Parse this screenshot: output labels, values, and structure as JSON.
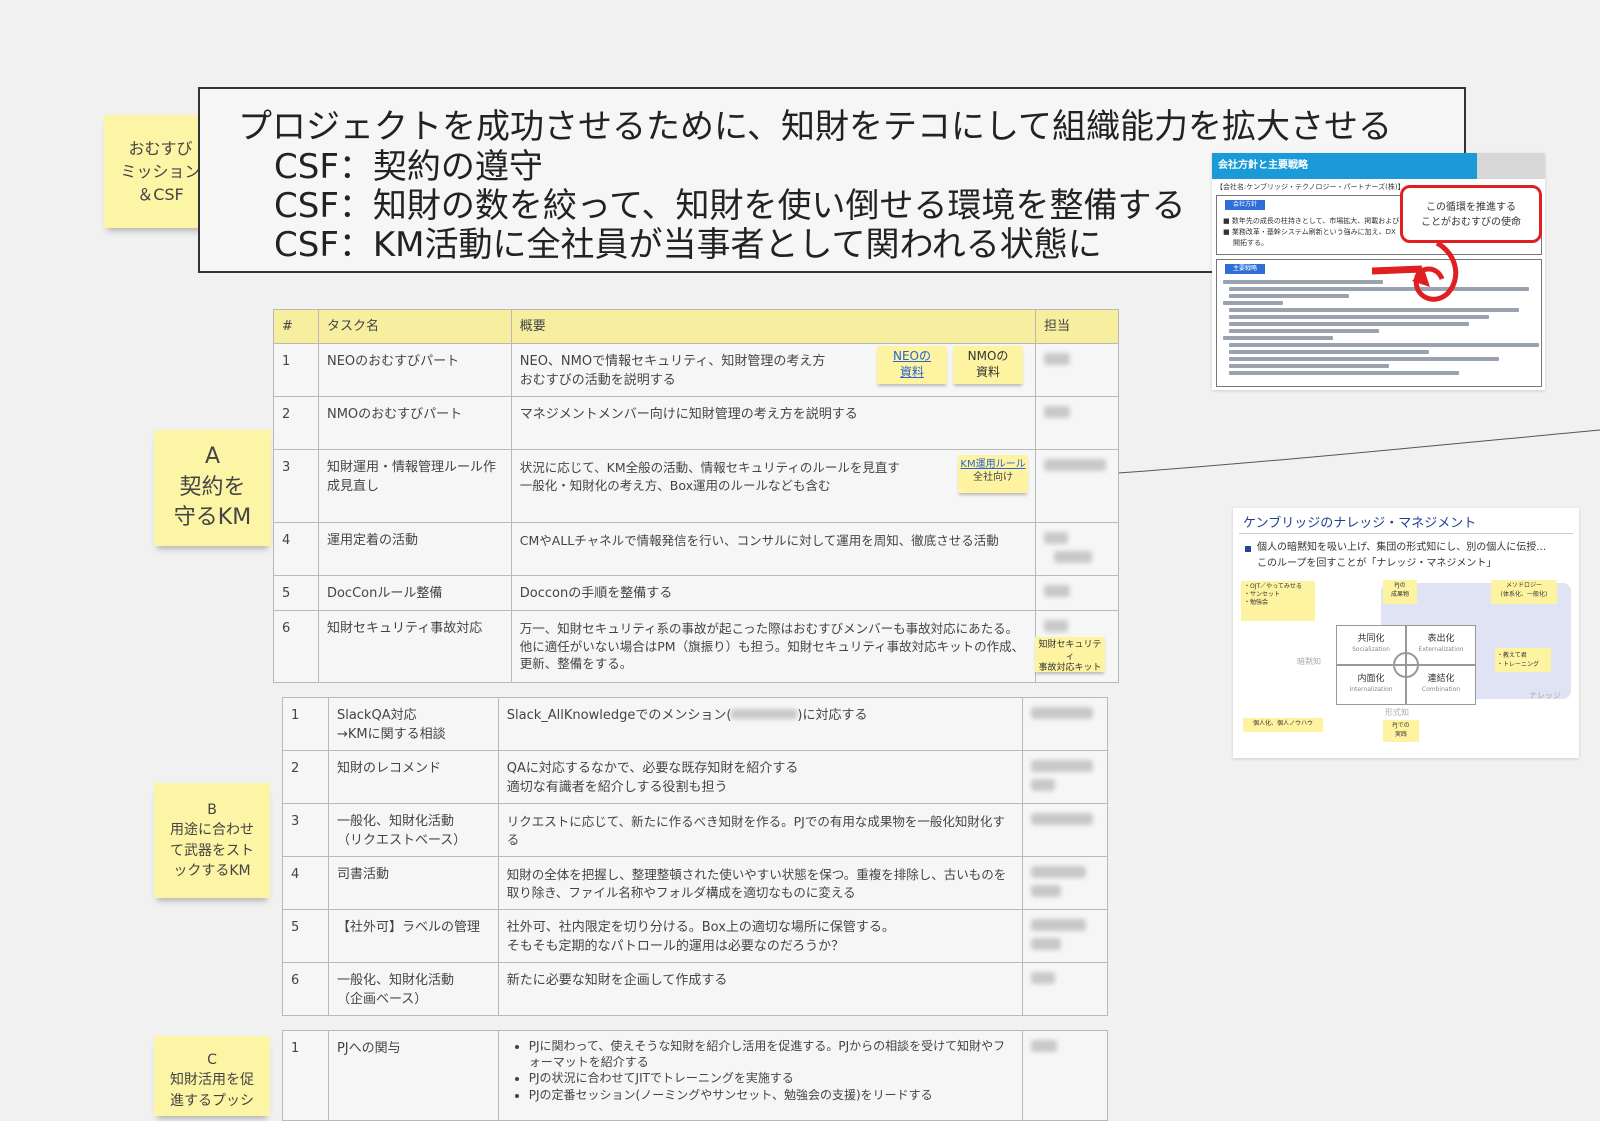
{
  "mission": {
    "sticky_label": "おむすび\nミッション\n＆CSF",
    "title": "プロジェクトを成功させるために、知財をテコにして組織能力を拡大させる",
    "csf": [
      "CSF：契約の遵守",
      "CSF：知財の数を絞って、知財を使い倒せる環境を整備する",
      "CSF：KM活動に全社員が当事者として関われる状態に"
    ]
  },
  "section_labels": {
    "a": "A\n契約を\n守るKM",
    "b": "B\n用途に合わせ\nて武器をスト\nックするKM",
    "c": "C\n知財活用を促\n進するプッシ"
  },
  "table_a": {
    "headers": [
      "#",
      "タスク名",
      "概要",
      "担当"
    ],
    "rows": [
      {
        "num": "1",
        "task": "NEOのおむすびパート",
        "summary": "NEO、NMOで情報セキュリティ、知財管理の考え方\nおむすびの活動を説明する"
      },
      {
        "num": "2",
        "task": "NMOのおむすびパート",
        "summary": "マネジメントメンバー向けに知財管理の考え方を説明する"
      },
      {
        "num": "3",
        "task": "知財運用・情報管理ルール作成見直し",
        "summary": "状況に応じて、KM全般の活動、情報セキュリティのルールを見直す\n一般化・知財化の考え方、Box運用のルールなども含む"
      },
      {
        "num": "4",
        "task": "運用定着の活動",
        "summary": "CMやALLチャネルで情報発信を行い、コンサルに対して運用を周知、徹底させる活動"
      },
      {
        "num": "5",
        "task": "DocConルール整備",
        "summary": "Docconの手順を整備する"
      },
      {
        "num": "6",
        "task": "知財セキュリティ事故対応",
        "summary": "万一、知財セキュリティ系の事故が起こった際はおむすびメンバーも事故対応にあたる。他に適任がいない場合はPM（旗振り）も担う。知財セキュリティ事故対応キットの作成、更新、整備をする。"
      }
    ]
  },
  "table_b": {
    "rows": [
      {
        "num": "1",
        "task": "SlackQA対応\n→KMに関する相談",
        "summary_pre": "Slack_AllKnowledgeでのメンション(",
        "summary_post": ")に対応する"
      },
      {
        "num": "2",
        "task": "知財のレコメンド",
        "summary": "QAに対応するなかで、必要な既存知財を紹介する\n適切な有識者を紹介しする役割も担う"
      },
      {
        "num": "3",
        "task": "一般化、知財化活動\n（リクエストベース）",
        "summary": "リクエストに応じて、新たに作るべき知財を作る。PJでの有用な成果物を一般化知財化する"
      },
      {
        "num": "4",
        "task": "司書活動",
        "summary": "知財の全体を把握し、整理整頓された使いやすい状態を保つ。重複を排除し、古いものを取り除き、ファイル名称やフォルダ構成を適切なものに変える"
      },
      {
        "num": "5",
        "task": "【社外可】ラベルの管理",
        "summary": "社外可、社内限定を切り分ける。Box上の適切な場所に保管する。\nそもそも定期的なパトロール的運用は必要なのだろうか？"
      },
      {
        "num": "6",
        "task": "一般化、知財化活動\n（企画ベース）",
        "summary": "新たに必要な知財を企画して作成する"
      }
    ]
  },
  "table_c": {
    "rows": [
      {
        "num": "1",
        "task": "PJへの関与",
        "bullets": [
          "PJに関わって、使えそうな知財を紹介し活用を促進する。PJからの相談を受けて知財やフォーマットを紹介する",
          "PJの状況に合わせてJITでトレーニングを実施する",
          "PJの定番セッション(ノーミングやサンセット、勉強会の支援)をリードする"
        ]
      }
    ]
  },
  "notes": {
    "neo_doc": "NEOの\n資料",
    "nmo_doc": "NMOの\n資料",
    "km_rule": "KM運用ルール",
    "km_rule_sub": "全社向け",
    "incident_kit": "知財セキュリティ\n事故対応キット"
  },
  "thumb_policy": {
    "header": "会社方針と主要戦略",
    "company": "【会社名:ケンブリッジ・テクノロジー・パートナーズ(株)】",
    "tag1": "会社方針",
    "bullet1": "数年先の成長の柱持きとして、市場拡大、掲載および",
    "bullet2": "業務改革・基幹システム刷新という強みに加え、DX",
    "bullet3": "開拓する。",
    "tag2": "主要戦略",
    "callout": "この循環を推進する\nことがおむすびの使命"
  },
  "thumb_km": {
    "title": "ケンブリッジのナレッジ・マネジメント",
    "bullet": "個人の暗黙知を吸い上げ、集団の形式知にし、別の個人に伝授…\nこのループを回すことが「ナレッジ・マネジメント」",
    "boxes": [
      {
        "main": "共同化",
        "sub": "Socialization"
      },
      {
        "main": "表出化",
        "sub": "Externalization"
      },
      {
        "main": "内面化",
        "sub": "Internalization"
      },
      {
        "main": "連結化",
        "sub": "Combination"
      }
    ],
    "notes": [
      "・OJT／やってみせる\n・サンセット\n・勉強会",
      "PJの\n成果物",
      "メソドロジー\n(体系化、一般化)",
      "・教えて君\n・トレーニング",
      "個人化、個人ノウハウ",
      "PJでの\n実践"
    ],
    "labels": [
      "暗黙知",
      "形式知",
      "ナレッジ"
    ]
  },
  "colors": {
    "sticky": "#fdf5a6",
    "header": "#f7ee9f",
    "callout": "#e02020",
    "brand": "#1a9ad6"
  }
}
